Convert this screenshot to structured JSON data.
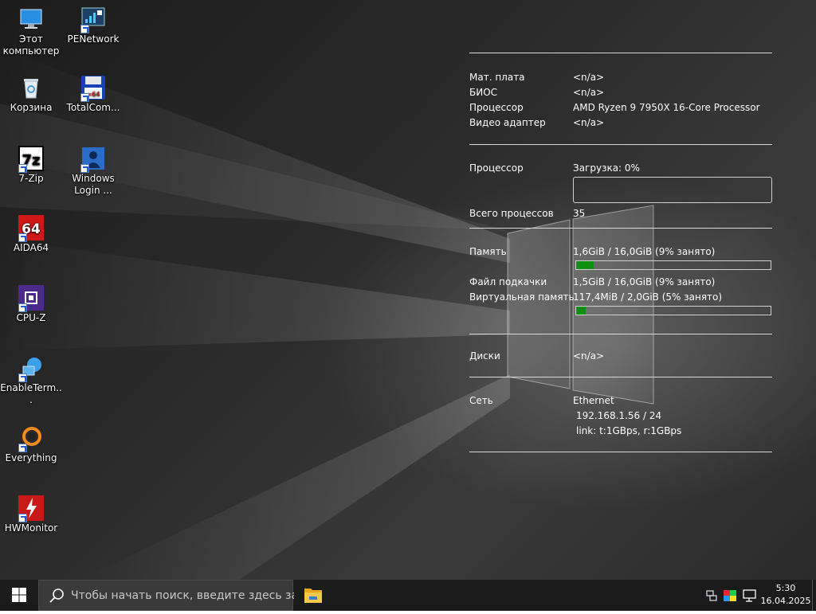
{
  "desktop_icons": [
    {
      "label": "Этот компьютер",
      "icon": "computer-icon"
    },
    {
      "label": "PENetwork",
      "icon": "network-icon"
    },
    {
      "label": "Корзина",
      "icon": "recycle-bin-icon"
    },
    {
      "label": "TotalCom...",
      "icon": "total-commander-icon"
    },
    {
      "label": "7-Zip",
      "icon": "7zip-icon"
    },
    {
      "label": "Windows Login ...",
      "icon": "windows-login-icon"
    },
    {
      "label": "AIDA64",
      "icon": "aida64-icon"
    },
    {
      "label": "CPU-Z",
      "icon": "cpuz-icon"
    },
    {
      "label": "EnableTerm...",
      "icon": "enable-terminal-icon"
    },
    {
      "label": "Everything",
      "icon": "everything-icon"
    },
    {
      "label": "HWMonitor",
      "icon": "hwmonitor-icon"
    }
  ],
  "sysinfo": {
    "motherboard": {
      "label": "Мат. плата",
      "value": "<n/a>"
    },
    "bios": {
      "label": "БИОС",
      "value": "<n/a>"
    },
    "cpu": {
      "label": "Процессор",
      "value": "AMD Ryzen 9 7950X 16-Core Processor"
    },
    "gpu": {
      "label": "Видео адаптер",
      "value": "<n/a>"
    },
    "cpu_load": {
      "label": "Процессор",
      "value": "Загрузка:  0%",
      "percent": 0
    },
    "processes": {
      "label": "Всего процессов",
      "value": "35"
    },
    "memory": {
      "label": "Память",
      "value": "1,6GiB / 16,0GiB (9% занято)",
      "percent": 9
    },
    "pagefile": {
      "label": "Файл подкачки",
      "value": "1,5GiB / 16,0GiB (9% занято)"
    },
    "virtual": {
      "label": "Виртуальная память",
      "value": "117,4MiB / 2,0GiB (5% занято)",
      "percent": 5
    },
    "disks": {
      "label": "Диски",
      "value": "<n/a>"
    },
    "network": {
      "label": "Сеть",
      "adapter": "Ethernet",
      "ip": "192.168.1.56 / 24",
      "link": "link: t:1GBps, r:1GBps"
    }
  },
  "taskbar": {
    "search_placeholder": "Чтобы начать поиск, введите здесь запрос",
    "time": "5:30",
    "date": "16.04.2025"
  },
  "colors": {
    "bar_fill": "#109010",
    "taskbar_bg": "#1b1b1b",
    "explorer_folder": "#f0c040"
  }
}
